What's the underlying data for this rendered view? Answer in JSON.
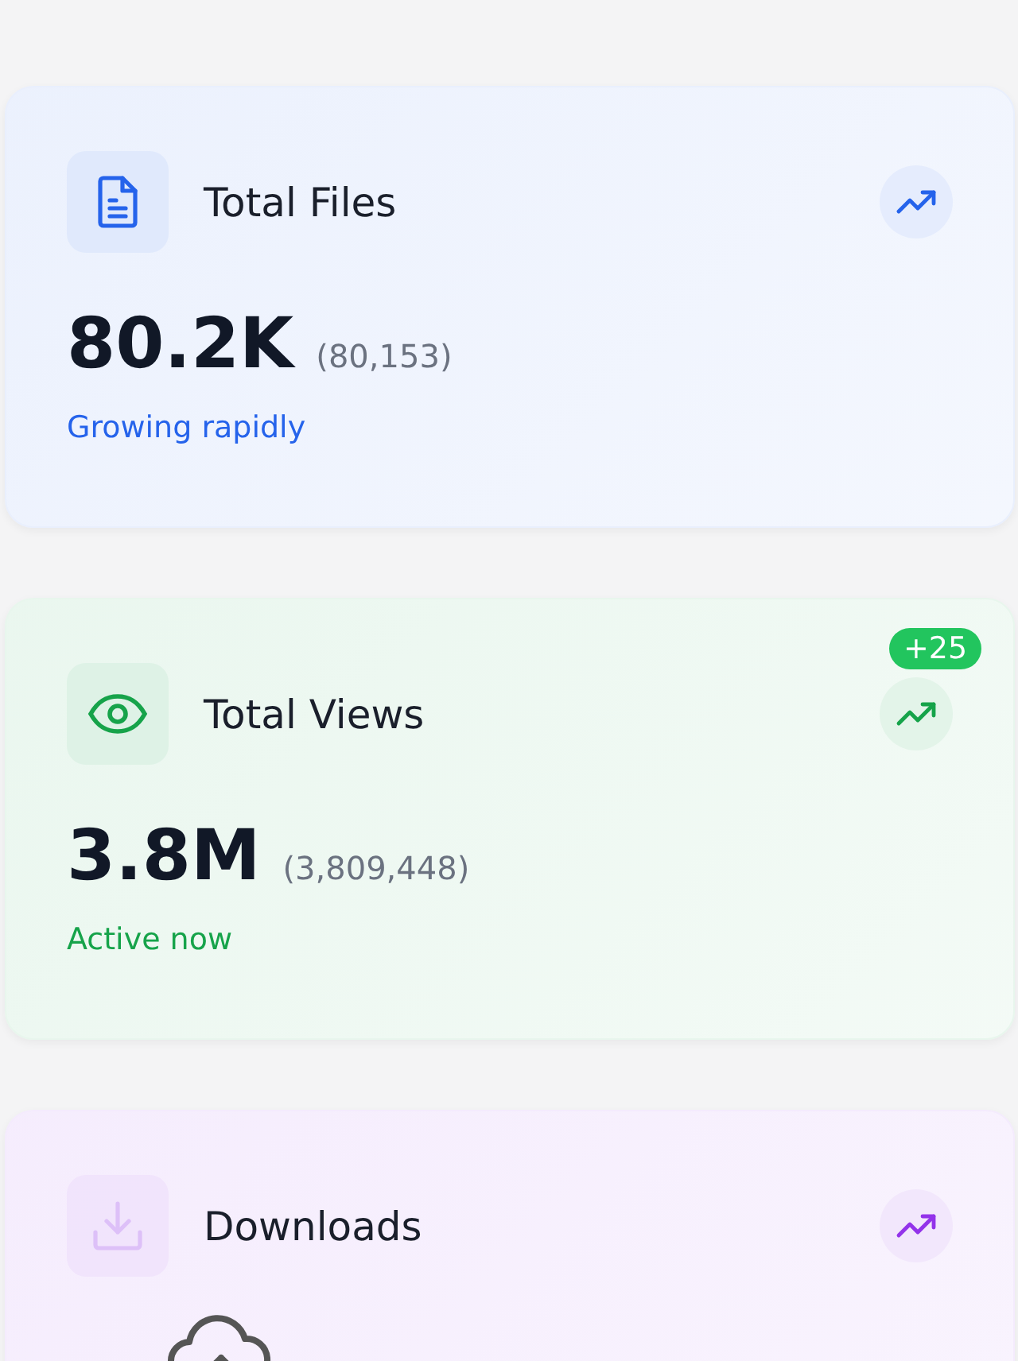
{
  "cards": [
    {
      "title": "Total Files",
      "value": "80.2K",
      "exact": "(80,153)",
      "status": "Growing rapidly",
      "kind": "document",
      "color": "#2563eb"
    },
    {
      "title": "Total Views",
      "value": "3.8M",
      "exact": "(3,809,448)",
      "status": "Active now",
      "kind": "eye",
      "color": "#16a34a",
      "badge": "+25"
    },
    {
      "title": "Downloads",
      "kind": "download",
      "color": "#9333ea"
    }
  ]
}
